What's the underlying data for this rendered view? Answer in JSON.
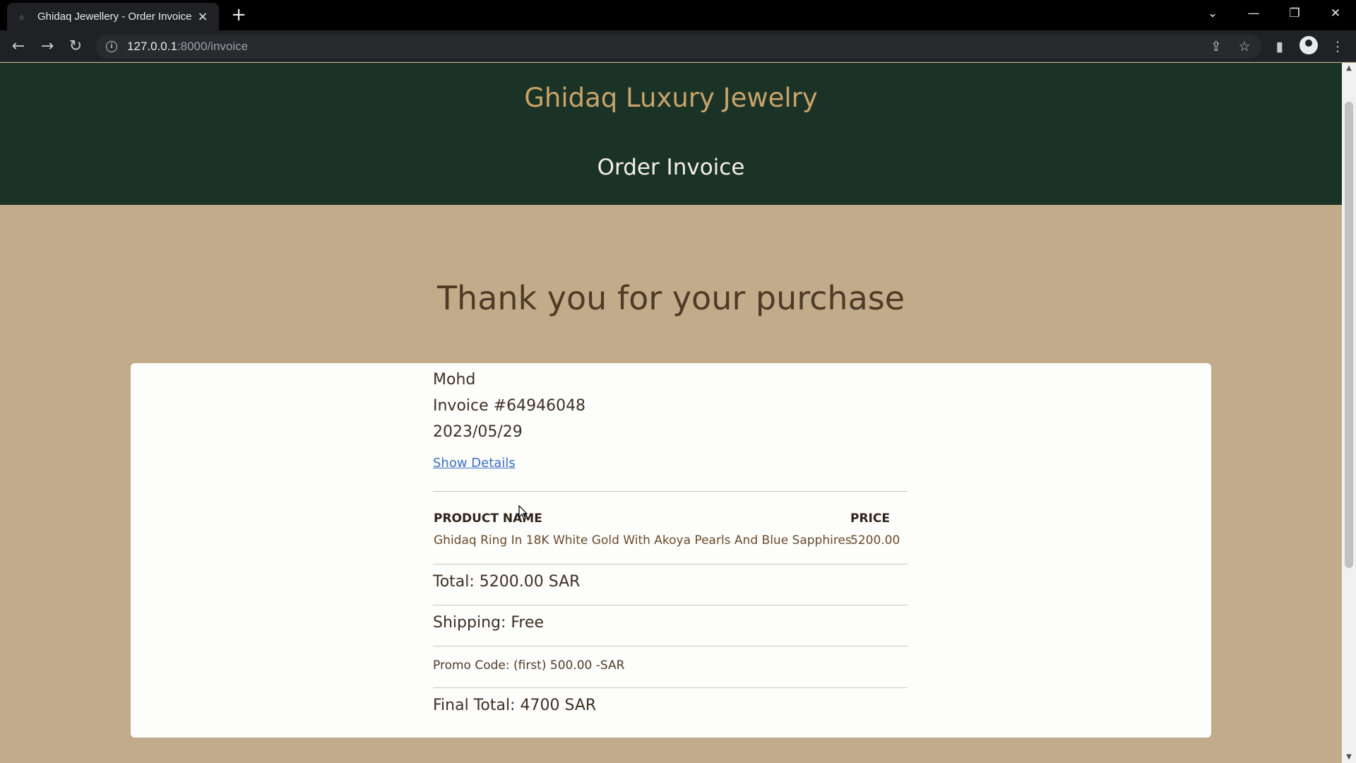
{
  "browser": {
    "tab_title": "Ghidaq Jewellery - Order Invoice",
    "url_host": "127.0.0.1",
    "url_path": ":8000/invoice",
    "icons": {
      "back": "back-arrow-icon",
      "forward": "forward-arrow-icon",
      "reload": "reload-icon",
      "share": "share-icon",
      "bookmark": "star-icon",
      "sidepanel": "side-panel-icon",
      "profile": "profile-icon",
      "menu": "kebab-menu-icon"
    }
  },
  "header": {
    "brand": "Ghidaq Luxury Jewelry",
    "subtitle": "Order Invoice"
  },
  "main": {
    "heading": "Thank you for your purchase"
  },
  "invoice": {
    "customer": "Mohd",
    "number": "Invoice #64946048",
    "date": "2023/05/29",
    "show_details": "Show Details",
    "table": {
      "headers": [
        "PRODUCT NAME",
        "PRICE"
      ],
      "rows": [
        [
          "Ghidaq Ring In 18K White Gold With Akoya Pearls And Blue Sapphires",
          "5200.00"
        ]
      ]
    },
    "total": "Total: 5200.00 SAR",
    "shipping": "Shipping: Free",
    "promo": "Promo Code: (first) 500.00 -SAR",
    "final_total": "Final Total: 4700 SAR"
  },
  "colors": {
    "header_bg": "#1b3326",
    "brand_gold": "#c9a36b",
    "page_bg": "#c2ab8a",
    "heading_brown": "#4f3a26",
    "link_blue": "#3b6fc4"
  }
}
